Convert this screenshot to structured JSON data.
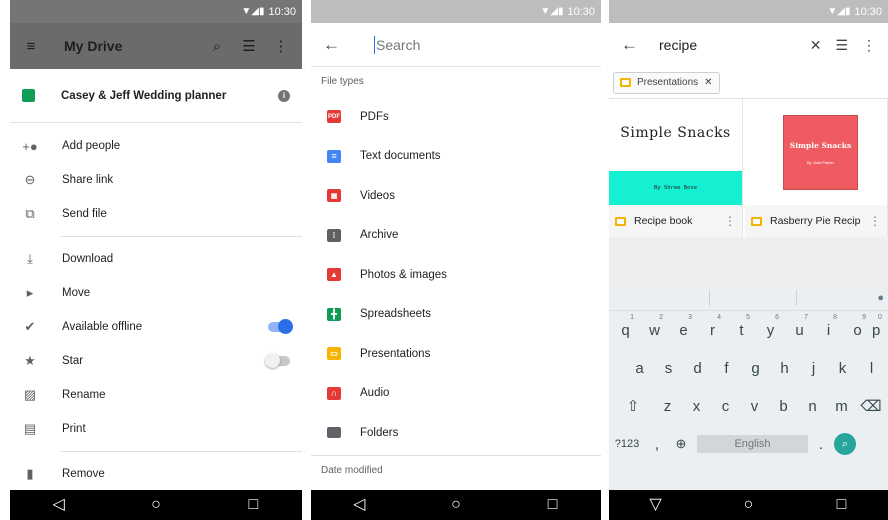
{
  "status": {
    "time": "10:30"
  },
  "screen1": {
    "toolbar": {
      "title": "My Drive"
    },
    "file": {
      "name": "Casey & Jeff Wedding planner"
    },
    "menu": [
      {
        "label": "Add people",
        "icon": "add-person-icon"
      },
      {
        "label": "Share link",
        "icon": "link-icon"
      },
      {
        "label": "Send file",
        "icon": "send-icon"
      },
      {
        "label": "Download",
        "icon": "download-icon"
      },
      {
        "label": "Move",
        "icon": "move-folder-icon"
      },
      {
        "label": "Available offline",
        "icon": "offline-icon",
        "toggle": true
      },
      {
        "label": "Star",
        "icon": "star-icon",
        "toggle": false
      },
      {
        "label": "Rename",
        "icon": "rename-icon"
      },
      {
        "label": "Print",
        "icon": "print-icon"
      },
      {
        "label": "Remove",
        "icon": "trash-icon"
      }
    ]
  },
  "screen2": {
    "search": {
      "placeholder": "Search"
    },
    "section_file_types": "File types",
    "section_date_modified": "Date modified",
    "types": [
      {
        "label": "PDFs",
        "color": "#e53935",
        "badge": "PDF"
      },
      {
        "label": "Text documents",
        "color": "#4285f4"
      },
      {
        "label": "Videos",
        "color": "#e53935"
      },
      {
        "label": "Archive",
        "color": "#616161"
      },
      {
        "label": "Photos & images",
        "color": "#e53935"
      },
      {
        "label": "Spreadsheets",
        "color": "#0f9d58"
      },
      {
        "label": "Presentations",
        "color": "#f4b400"
      },
      {
        "label": "Audio",
        "color": "#e53935"
      },
      {
        "label": "Folders",
        "color": "#5f6368"
      }
    ]
  },
  "screen3": {
    "query": "recipe",
    "filter_chip": "Presentations",
    "results": [
      {
        "name": "Recipe book",
        "thumb_title": "Simple Snacks",
        "thumb_byline": "By Shree Bose",
        "accent": "#16f0d2"
      },
      {
        "name": "Rasberry Pie Recipe",
        "thumb_title": "Simple Snacks",
        "thumb_byline": "By Josh Parker",
        "accent": "#ef5b60"
      }
    ],
    "keyboard": {
      "row1": [
        {
          "k": "q",
          "n": "1"
        },
        {
          "k": "w",
          "n": "2"
        },
        {
          "k": "e",
          "n": "3"
        },
        {
          "k": "r",
          "n": "4"
        },
        {
          "k": "t",
          "n": "5"
        },
        {
          "k": "y",
          "n": "6"
        },
        {
          "k": "u",
          "n": "7"
        },
        {
          "k": "i",
          "n": "8"
        },
        {
          "k": "o",
          "n": "9"
        },
        {
          "k": "p",
          "n": "0"
        }
      ],
      "row2": [
        "a",
        "s",
        "d",
        "f",
        "g",
        "h",
        "j",
        "k",
        "l"
      ],
      "row3": [
        "z",
        "x",
        "c",
        "v",
        "b",
        "n",
        "m"
      ],
      "symbols_key": "?123",
      "comma": ",",
      "period": ".",
      "space_label": "English"
    }
  }
}
